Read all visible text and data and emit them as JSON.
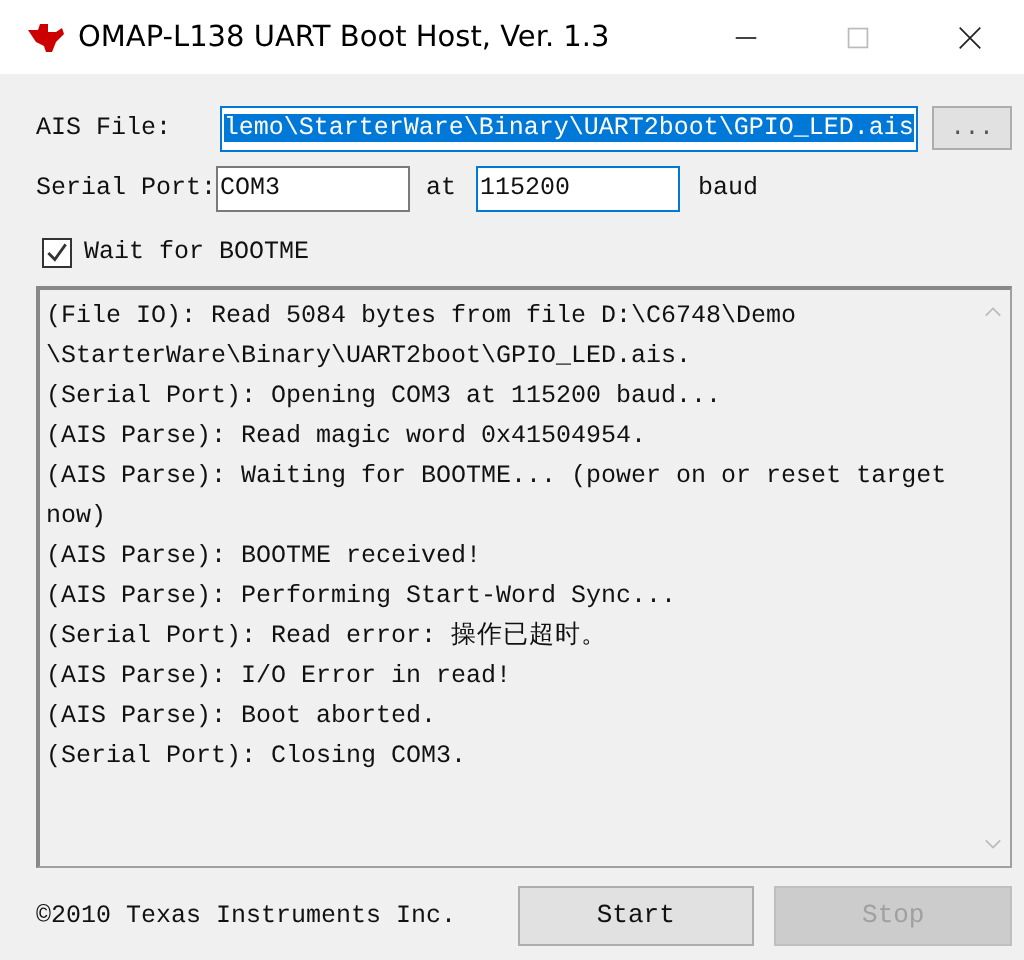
{
  "window": {
    "title": "OMAP-L138 UART Boot Host, Ver. 1.3"
  },
  "ais_file": {
    "label": "AIS File:",
    "value": "lemo\\StarterWare\\Binary\\UART2boot\\GPIO_LED.ais",
    "selected": true,
    "browse": "..."
  },
  "serial_port": {
    "label": "Serial Port:",
    "port": "COM3",
    "at": "at",
    "baud_rate": "115200",
    "baud": "baud"
  },
  "wait_for_bootme": {
    "label": "Wait for BOOTME",
    "checked": true
  },
  "log": [
    "(File IO): Read 5084 bytes from file D:\\C6748\\Demo",
    "\\StarterWare\\Binary\\UART2boot\\GPIO_LED.ais.",
    "(Serial Port): Opening COM3 at 115200 baud...",
    "(AIS Parse): Read magic word 0x41504954.",
    "(AIS Parse): Waiting for BOOTME... (power on or reset target",
    "now)",
    "(AIS Parse): BOOTME received!",
    "(AIS Parse): Performing Start-Word Sync...",
    "(Serial Port): Read error: 操作已超时。",
    "(AIS Parse): I/O Error in read!",
    "(AIS Parse): Boot aborted.",
    "(Serial Port): Closing COM3."
  ],
  "footer": {
    "copyright": "©2010 Texas Instruments Inc.",
    "buttons": [
      {
        "label": "Start",
        "disabled": false
      },
      {
        "label": "Stop",
        "disabled": true
      }
    ]
  }
}
